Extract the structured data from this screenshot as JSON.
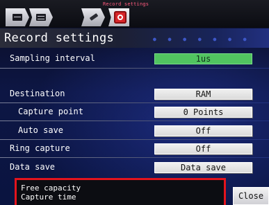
{
  "tabs": [
    {
      "icon": "display-icon"
    },
    {
      "icon": "waveform-icon"
    },
    {
      "icon": "pen-icon"
    },
    {
      "icon": "record-icon",
      "active": true
    }
  ],
  "tab_caption": "Record settings",
  "title": "Record settings",
  "rows": {
    "sampling_interval": {
      "label": "Sampling interval",
      "value": "1us"
    },
    "destination": {
      "label": "Destination",
      "value": "RAM"
    },
    "capture_point": {
      "label": "Capture point",
      "value": "0 Points"
    },
    "auto_save": {
      "label": "Auto save",
      "value": "Off"
    },
    "ring_capture": {
      "label": "Ring capture",
      "value": "Off"
    },
    "data_save": {
      "label": "Data save",
      "value": "Data save"
    }
  },
  "info": {
    "free_capacity_label": "Free capacity",
    "capture_time_label": "Capture time"
  },
  "close_label": "Close",
  "colors": {
    "accent_green": "#51c460",
    "highlight_red": "#e3141d",
    "caption_pink": "#ff5b7e"
  }
}
